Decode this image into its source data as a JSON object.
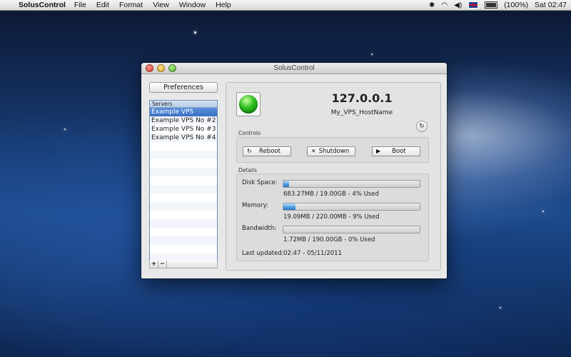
{
  "menubar": {
    "app_name": "SolusControl",
    "menus": [
      "File",
      "Edit",
      "Format",
      "View",
      "Window",
      "Help"
    ],
    "battery": "(100%)",
    "clock": "Sat 02:47"
  },
  "window": {
    "title": "SolusControl",
    "preferences_label": "Preferences",
    "servers": {
      "header": "Servers",
      "items": [
        "Example VPS",
        "Example VPS No #2",
        "Example VPS No #3",
        "Example VPS No #4"
      ],
      "selected_index": 0,
      "add_label": "+",
      "remove_label": "−"
    },
    "host": {
      "ip": "127.0.0.1",
      "hostname": "My_VPS_HostName",
      "status_color": "#2bbd1e"
    },
    "controls": {
      "label": "Controls",
      "reboot": "Reboot",
      "shutdown": "Shutdown",
      "boot": "Boot"
    },
    "details": {
      "label": "Details",
      "disk_label": "Disk Space:",
      "disk_value": "683.27MB / 19.00GB - 4% Used",
      "disk_used_percent": 4,
      "memory_label": "Memory:",
      "memory_value": "19.09MB / 220.00MB - 9% Used",
      "memory_used_percent": 9,
      "bandwidth_label": "Bandwidth:",
      "bandwidth_value": "1.72MB / 190.00GB - 0% Used",
      "bandwidth_used_percent": 0,
      "updated_label": "Last updated:",
      "updated_value": "02:47 - 05/11/2011"
    }
  }
}
